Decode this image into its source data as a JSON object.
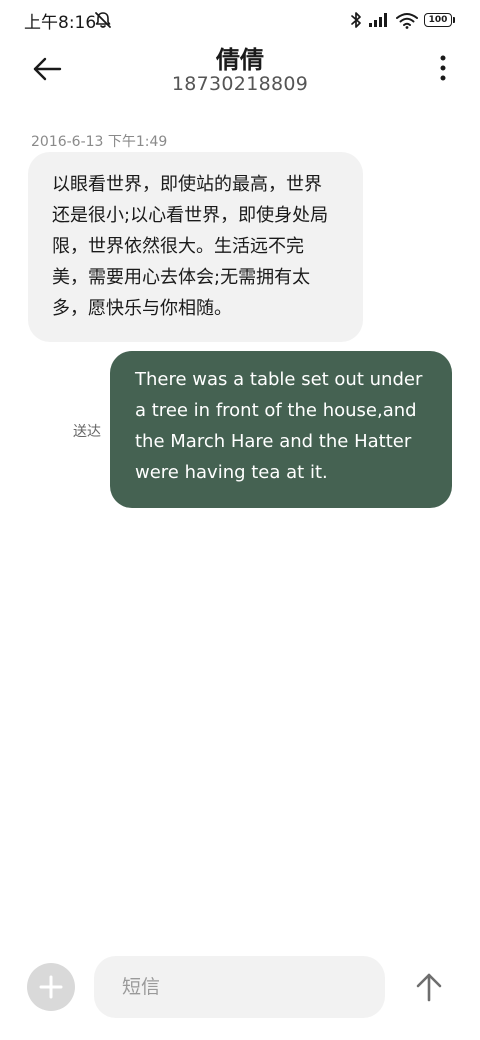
{
  "status_bar": {
    "time": "上午8:16",
    "battery": "100",
    "icons": [
      "do-not-disturb-icon",
      "bluetooth-icon",
      "signal-icon",
      "wifi-icon",
      "battery-icon"
    ]
  },
  "header": {
    "title": "倩倩",
    "subtitle": "18730218809",
    "icons": [
      "back-arrow-icon",
      "more-vertical-icon"
    ]
  },
  "messages": [
    {
      "direction": "incoming",
      "timestamp": "2016-6-13 下午1:49",
      "text": "以眼看世界，即使站的最高，世界还是很小;以心看世界，即使身处局限，世界依然很大。生活远不完美，需要用心去体会;无需拥有太多，愿快乐与你相随。"
    },
    {
      "direction": "outgoing",
      "status": "送达",
      "text": "There was a table set out under a tree in front of the house,and the March Hare and the Hatter were having tea at it."
    }
  ],
  "composer": {
    "placeholder": "短信",
    "value": "",
    "icons": [
      "plus-icon",
      "send-arrow-icon"
    ]
  },
  "colors": {
    "incoming_bubble": "#f2f2f2",
    "outgoing_bubble": "#456252",
    "add_button": "#d9d9d9"
  }
}
